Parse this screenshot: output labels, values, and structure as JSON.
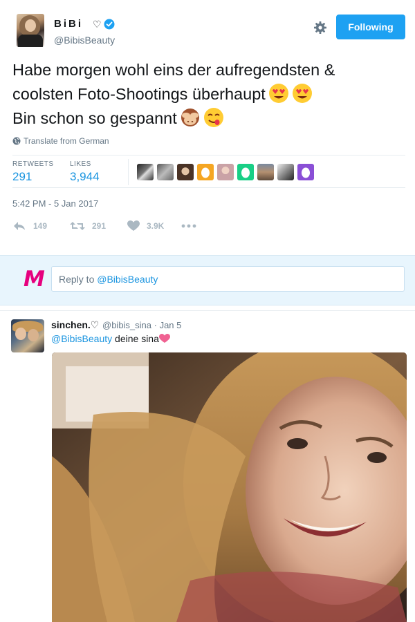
{
  "tweet": {
    "display_name": "BiBi",
    "heart": "♡",
    "screen_name": "@BibisBeauty",
    "follow_label": "Following",
    "text_lines": [
      "Habe morgen wohl eins der aufregendsten &",
      "coolsten Foto-Shootings überhaupt",
      "Bin schon so gespannt"
    ],
    "translate_label": "Translate from German",
    "stats": {
      "retweets_label": "RETWEETS",
      "retweets_value": "291",
      "likes_label": "LIKES",
      "likes_value": "3,944"
    },
    "timestamp": "5:42 PM - 5 Jan 2017",
    "actions": {
      "reply_count": "149",
      "retweet_count": "291",
      "like_count": "3.9K"
    }
  },
  "reply_box": {
    "logo": "M",
    "prefix": "Reply to ",
    "mention": "@BibisBeauty"
  },
  "reply": {
    "name": "sinchen.♡",
    "meta": "@bibis_sina · Jan 5",
    "mention": "@BibisBeauty",
    "text": " deine sina"
  },
  "colors": {
    "accent": "#1da1f2",
    "link": "#1b95e0",
    "muted": "#657786",
    "reply_bg": "#e8f5fd"
  },
  "icons": [
    "verified-icon",
    "gear-icon",
    "globe-icon",
    "reply-icon",
    "retweet-icon",
    "heart-icon",
    "more-icon"
  ]
}
